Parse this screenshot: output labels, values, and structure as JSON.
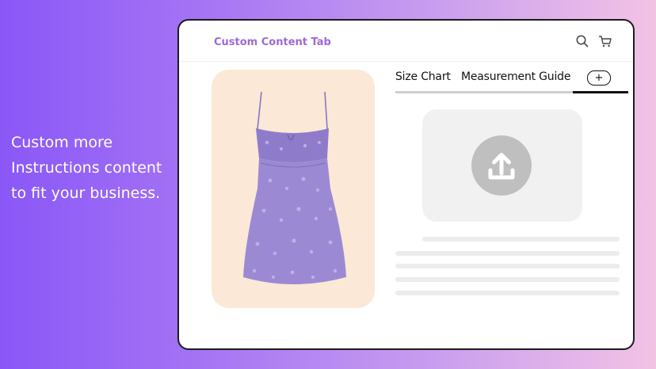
{
  "tagline": {
    "lines": [
      "Custom more",
      "Instructions content",
      "to fit your business."
    ]
  },
  "app": {
    "title": "Custom Content Tab",
    "header_icons": [
      "search-icon",
      "cart-icon"
    ]
  },
  "tabs": {
    "items": [
      "Size Chart",
      "Measurement Guide"
    ],
    "add_label": "+",
    "active_index": 2
  },
  "upload": {
    "icon": "upload-icon"
  },
  "colors": {
    "accent": "#9b6ad7",
    "product_card_bg": "#fbe8d6",
    "dress": "#9b8ad3",
    "upload_circle": "#bfbfbf",
    "placeholder_line": "#ececec"
  }
}
